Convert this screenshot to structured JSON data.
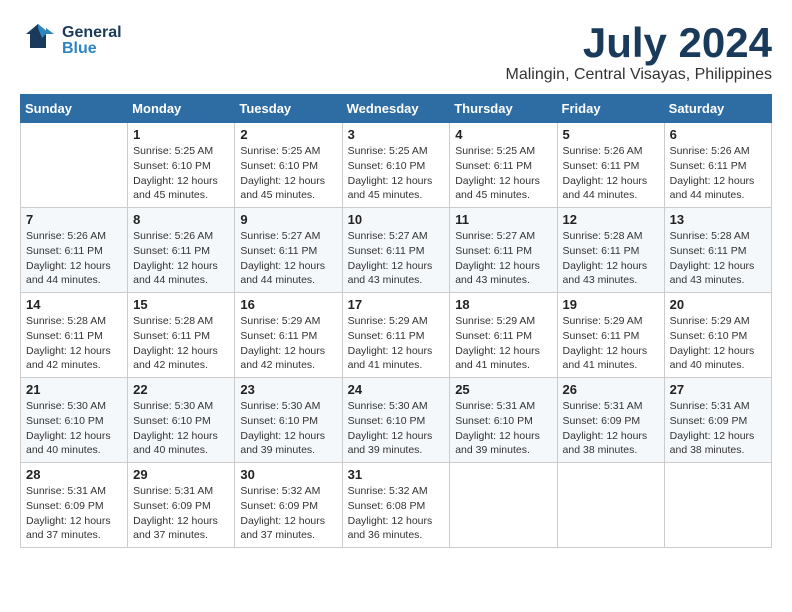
{
  "header": {
    "logo_general": "General",
    "logo_blue": "Blue",
    "month_title": "July 2024",
    "subtitle": "Malingin, Central Visayas, Philippines"
  },
  "days_of_week": [
    "Sunday",
    "Monday",
    "Tuesday",
    "Wednesday",
    "Thursday",
    "Friday",
    "Saturday"
  ],
  "weeks": [
    [
      {
        "day": "",
        "info": ""
      },
      {
        "day": "1",
        "info": "Sunrise: 5:25 AM\nSunset: 6:10 PM\nDaylight: 12 hours\nand 45 minutes."
      },
      {
        "day": "2",
        "info": "Sunrise: 5:25 AM\nSunset: 6:10 PM\nDaylight: 12 hours\nand 45 minutes."
      },
      {
        "day": "3",
        "info": "Sunrise: 5:25 AM\nSunset: 6:10 PM\nDaylight: 12 hours\nand 45 minutes."
      },
      {
        "day": "4",
        "info": "Sunrise: 5:25 AM\nSunset: 6:11 PM\nDaylight: 12 hours\nand 45 minutes."
      },
      {
        "day": "5",
        "info": "Sunrise: 5:26 AM\nSunset: 6:11 PM\nDaylight: 12 hours\nand 44 minutes."
      },
      {
        "day": "6",
        "info": "Sunrise: 5:26 AM\nSunset: 6:11 PM\nDaylight: 12 hours\nand 44 minutes."
      }
    ],
    [
      {
        "day": "7",
        "info": "Sunrise: 5:26 AM\nSunset: 6:11 PM\nDaylight: 12 hours\nand 44 minutes."
      },
      {
        "day": "8",
        "info": "Sunrise: 5:26 AM\nSunset: 6:11 PM\nDaylight: 12 hours\nand 44 minutes."
      },
      {
        "day": "9",
        "info": "Sunrise: 5:27 AM\nSunset: 6:11 PM\nDaylight: 12 hours\nand 44 minutes."
      },
      {
        "day": "10",
        "info": "Sunrise: 5:27 AM\nSunset: 6:11 PM\nDaylight: 12 hours\nand 43 minutes."
      },
      {
        "day": "11",
        "info": "Sunrise: 5:27 AM\nSunset: 6:11 PM\nDaylight: 12 hours\nand 43 minutes."
      },
      {
        "day": "12",
        "info": "Sunrise: 5:28 AM\nSunset: 6:11 PM\nDaylight: 12 hours\nand 43 minutes."
      },
      {
        "day": "13",
        "info": "Sunrise: 5:28 AM\nSunset: 6:11 PM\nDaylight: 12 hours\nand 43 minutes."
      }
    ],
    [
      {
        "day": "14",
        "info": "Sunrise: 5:28 AM\nSunset: 6:11 PM\nDaylight: 12 hours\nand 42 minutes."
      },
      {
        "day": "15",
        "info": "Sunrise: 5:28 AM\nSunset: 6:11 PM\nDaylight: 12 hours\nand 42 minutes."
      },
      {
        "day": "16",
        "info": "Sunrise: 5:29 AM\nSunset: 6:11 PM\nDaylight: 12 hours\nand 42 minutes."
      },
      {
        "day": "17",
        "info": "Sunrise: 5:29 AM\nSunset: 6:11 PM\nDaylight: 12 hours\nand 41 minutes."
      },
      {
        "day": "18",
        "info": "Sunrise: 5:29 AM\nSunset: 6:11 PM\nDaylight: 12 hours\nand 41 minutes."
      },
      {
        "day": "19",
        "info": "Sunrise: 5:29 AM\nSunset: 6:11 PM\nDaylight: 12 hours\nand 41 minutes."
      },
      {
        "day": "20",
        "info": "Sunrise: 5:29 AM\nSunset: 6:10 PM\nDaylight: 12 hours\nand 40 minutes."
      }
    ],
    [
      {
        "day": "21",
        "info": "Sunrise: 5:30 AM\nSunset: 6:10 PM\nDaylight: 12 hours\nand 40 minutes."
      },
      {
        "day": "22",
        "info": "Sunrise: 5:30 AM\nSunset: 6:10 PM\nDaylight: 12 hours\nand 40 minutes."
      },
      {
        "day": "23",
        "info": "Sunrise: 5:30 AM\nSunset: 6:10 PM\nDaylight: 12 hours\nand 39 minutes."
      },
      {
        "day": "24",
        "info": "Sunrise: 5:30 AM\nSunset: 6:10 PM\nDaylight: 12 hours\nand 39 minutes."
      },
      {
        "day": "25",
        "info": "Sunrise: 5:31 AM\nSunset: 6:10 PM\nDaylight: 12 hours\nand 39 minutes."
      },
      {
        "day": "26",
        "info": "Sunrise: 5:31 AM\nSunset: 6:09 PM\nDaylight: 12 hours\nand 38 minutes."
      },
      {
        "day": "27",
        "info": "Sunrise: 5:31 AM\nSunset: 6:09 PM\nDaylight: 12 hours\nand 38 minutes."
      }
    ],
    [
      {
        "day": "28",
        "info": "Sunrise: 5:31 AM\nSunset: 6:09 PM\nDaylight: 12 hours\nand 37 minutes."
      },
      {
        "day": "29",
        "info": "Sunrise: 5:31 AM\nSunset: 6:09 PM\nDaylight: 12 hours\nand 37 minutes."
      },
      {
        "day": "30",
        "info": "Sunrise: 5:32 AM\nSunset: 6:09 PM\nDaylight: 12 hours\nand 37 minutes."
      },
      {
        "day": "31",
        "info": "Sunrise: 5:32 AM\nSunset: 6:08 PM\nDaylight: 12 hours\nand 36 minutes."
      },
      {
        "day": "",
        "info": ""
      },
      {
        "day": "",
        "info": ""
      },
      {
        "day": "",
        "info": ""
      }
    ]
  ]
}
